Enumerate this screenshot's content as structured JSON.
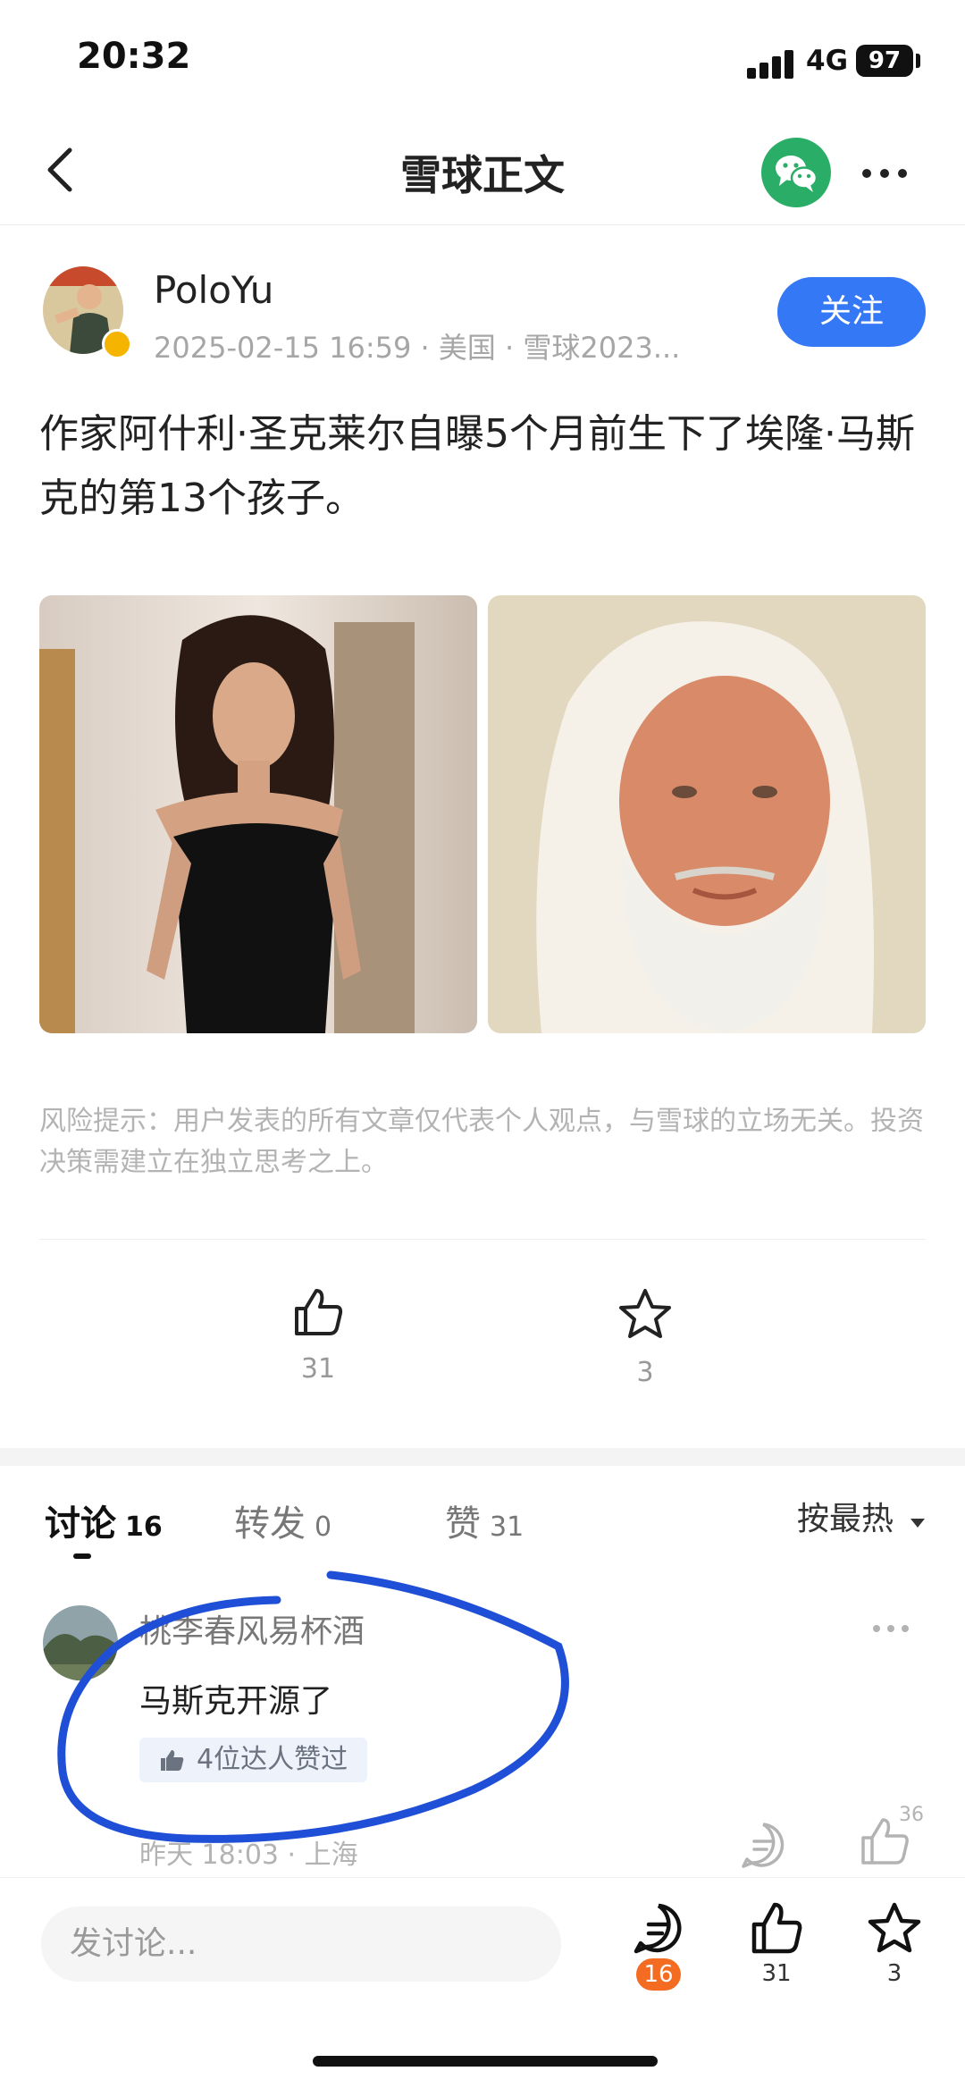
{
  "status_bar": {
    "time": "20:32",
    "network": "4G",
    "battery": "97"
  },
  "nav": {
    "title": "雪球正文",
    "wechat_icon": "wechat-icon",
    "more_icon": "more-icon"
  },
  "author": {
    "name": "PoloYu",
    "meta": "2025-02-15 16:59 · 美国 · 雪球2023...",
    "follow_label": "关注",
    "badge_color": "#f5b400"
  },
  "post": {
    "text": "作家阿什利·圣克莱尔自曝5个月前生下了埃隆·马斯克的第13个孩子。",
    "risk_notice": "风险提示：用户发表的所有文章仅代表个人观点，与雪球的立场无关。投资决策需建立在独立思考之上。",
    "likes": "31",
    "favorites": "3"
  },
  "tabs": [
    {
      "label": "讨论",
      "count": "16"
    },
    {
      "label": "转发",
      "count": "0"
    },
    {
      "label": "赞",
      "count": "31"
    }
  ],
  "sort_label": "按最热",
  "comment": {
    "username": "桃李春风易杯酒",
    "text": "马斯克开源了",
    "badge": "4位达人赞过",
    "time": "昨天 18:03 · 上海",
    "like_count": "36"
  },
  "bottom_bar": {
    "placeholder": "发讨论...",
    "comments": "16",
    "likes": "31",
    "favorites": "3"
  },
  "colors": {
    "accent": "#3478f6",
    "wechat": "#2aae67",
    "badge": "#f36c21",
    "annotation": "#1f4fd6"
  }
}
